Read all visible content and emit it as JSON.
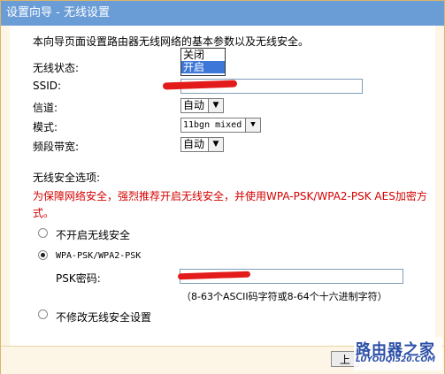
{
  "window": {
    "title": "设置向导 - 无线设置"
  },
  "intro": "本向导页面设置路由器无线网络的基本参数以及无线安全。",
  "fields": {
    "wireless_status_label": "无线状态:",
    "ssid_label": "SSID:",
    "channel_label": "信道:",
    "channel_value": "自动",
    "mode_label": "模式:",
    "mode_value": "11bgn mixed",
    "bandwidth_label": "频段带宽:",
    "bandwidth_value": "自动"
  },
  "wireless_status_dropdown": {
    "options": [
      "关闭",
      "开启"
    ],
    "highlighted": "开启"
  },
  "security": {
    "section_label": "无线安全选项:",
    "warning": "为保障网络安全，强烈推荐开启无线安全，并使用WPA-PSK/WPA2-PSK AES加密方式。",
    "warning_line1": "为保障网络安全，强烈推荐开启无线安全，并使用WPA-PSK/WPA2-PSK AES加密方",
    "warning_line2": "式。",
    "option_disable": "不开启无线安全",
    "option_wpa": "WPA-PSK/WPA2-PSK",
    "psk_label": "PSK密码:",
    "psk_hint": "（8-63个ASCII码字符或8-64个十六进制字符）",
    "option_keep": "不修改无线安全设置",
    "selected": "WPA-PSK/WPA2-PSK"
  },
  "footer": {
    "prev_button": "上"
  },
  "watermark": {
    "line1": "路由器之家",
    "line2": "LUYOUQI520.COM"
  },
  "colors": {
    "titlebar": "#6a9cd6",
    "warning": "#d40000",
    "frame_border": "#d9b56a",
    "redaction": "#e31b1b"
  }
}
